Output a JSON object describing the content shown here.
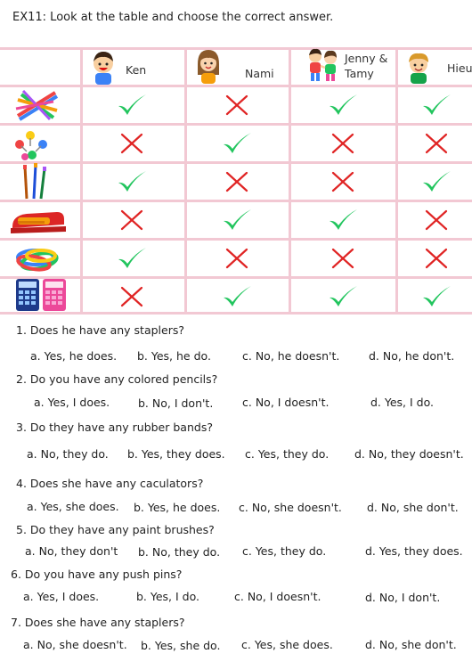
{
  "title": "EX11: Look at the table and choose the correct answer.",
  "table": {
    "columns": [
      "Ken",
      "Nami",
      "Jenny &",
      "Tamy",
      "Hieu"
    ],
    "rows": [
      {
        "item": "colored-pencils-icon",
        "marks": [
          "check",
          "cross",
          "check",
          "check"
        ]
      },
      {
        "item": "push-pins-icon",
        "marks": [
          "cross",
          "check",
          "cross",
          "cross"
        ]
      },
      {
        "item": "paint-brushes-icon",
        "marks": [
          "check",
          "cross",
          "cross",
          "check"
        ]
      },
      {
        "item": "stapler-icon",
        "marks": [
          "cross",
          "check",
          "check",
          "cross"
        ]
      },
      {
        "item": "rubber-bands-icon",
        "marks": [
          "check",
          "cross",
          "cross",
          "cross"
        ]
      },
      {
        "item": "calculators-icon",
        "marks": [
          "cross",
          "check",
          "check",
          "check"
        ]
      }
    ],
    "colors": {
      "check": "#22c55e",
      "cross": "#e02424",
      "grid": "#f2c8d3"
    }
  },
  "questions": [
    {
      "q": "1.  Does he have any staplers?",
      "options": [
        "a. Yes, he does.",
        "b. Yes, he do.",
        "c. No, he doesn't.",
        "d. No, he don't."
      ]
    },
    {
      "q": "2.  Do you have any colored pencils?",
      "options": [
        "a. Yes, I does.",
        "b. No, I don't.",
        "c. No, I doesn't.",
        "d. Yes, I do."
      ]
    },
    {
      "q": "3.  Do they have any rubber bands?",
      "options": [
        "a. No, they do.",
        "b. Yes, they does.",
        "c. Yes, they do.",
        "d. No, they doesn't."
      ]
    },
    {
      "q": "4.  Does she have any caculators?",
      "options": [
        "a. Yes, she does.",
        "b. Yes, he does.",
        "c. No, she doesn't.",
        "d. No, she don't."
      ]
    },
    {
      "q": "5.  Do they have any paint brushes?",
      "options": [
        "a. No, they don't",
        "b. No, they do.",
        "c. Yes, they do.",
        "d. Yes, they does."
      ]
    },
    {
      "q": "6.  Do you have any push pins?",
      "options": [
        "a. Yes, I does.",
        "b. Yes, I do.",
        "c. No, I doesn't.",
        "d. No, I don't."
      ]
    },
    {
      "q": "7.  Does she have any staplers?",
      "options": [
        "a. No, she doesn't.",
        "b. Yes, she do.",
        "c. Yes, she does.",
        "d. No, she don't."
      ]
    }
  ]
}
